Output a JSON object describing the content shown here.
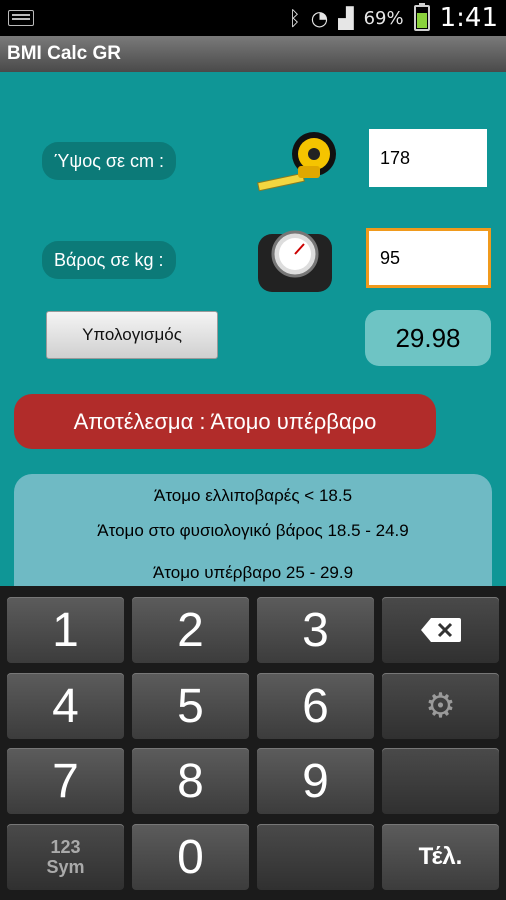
{
  "status_bar": {
    "battery_percent": "69%",
    "battery_level": 0.69,
    "time": "1:41",
    "icons": [
      "keyboard-icon",
      "bluetooth-icon",
      "wifi-icon",
      "signal-icon",
      "battery-icon"
    ]
  },
  "app": {
    "title": "BMI Calc GR"
  },
  "form": {
    "height_label": "Ύψος σε cm :",
    "height_value": "178",
    "weight_label": "Βάρος σε kg :",
    "weight_value": "95",
    "calculate_label": "Υπολογισμός",
    "bmi_value": "29.98"
  },
  "result": {
    "text": "Αποτέλεσμα : Άτομο υπέρβαρο"
  },
  "info": {
    "lines": [
      "Άτομο ελλιποβαρές < 18.5",
      "Άτομο στο φυσιολογικό βάρος 18.5 - 24.9",
      "Άτομο υπέρβαρο 25 - 29.9"
    ]
  },
  "keyboard": {
    "keys": [
      "1",
      "2",
      "3",
      "4",
      "5",
      "6",
      "7",
      "8",
      "9",
      "0"
    ],
    "sym_top": "123",
    "sym_bottom": "Sym",
    "done_label": "Τέλ."
  },
  "colors": {
    "background": "#0f9696",
    "result_red": "#b12c2a",
    "input_focus": "#f09a1c"
  }
}
